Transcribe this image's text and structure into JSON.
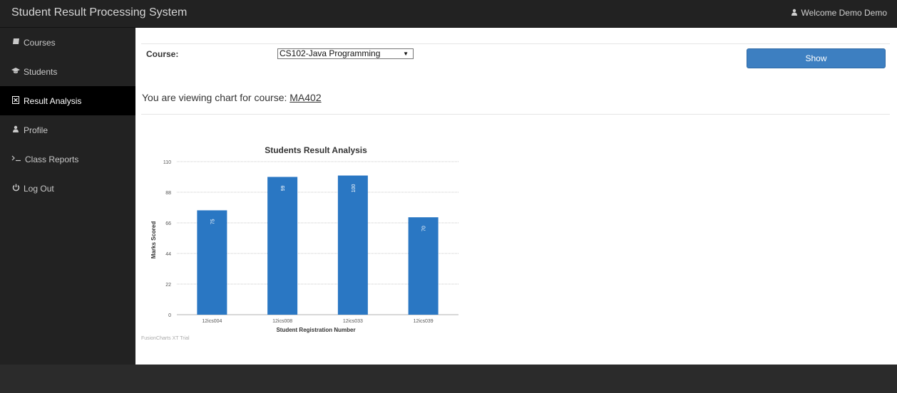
{
  "app": {
    "title": "Student Result Processing System",
    "welcome_text": "Welcome Demo Demo"
  },
  "sidebar": {
    "items": [
      {
        "label": "Courses",
        "icon": "book-icon",
        "active": false
      },
      {
        "label": "Students",
        "icon": "graduation-cap-icon",
        "active": false
      },
      {
        "label": "Result Analysis",
        "icon": "chart-file-icon",
        "active": true
      },
      {
        "label": "Profile",
        "icon": "user-icon",
        "active": false
      },
      {
        "label": "Class Reports",
        "icon": "terminal-icon",
        "active": false
      },
      {
        "label": "Log Out",
        "icon": "power-icon",
        "active": false
      }
    ]
  },
  "form": {
    "course_label": "Course:",
    "course_selected": "CS102-Java Programming",
    "show_button": "Show"
  },
  "viewing": {
    "prefix": "You are viewing chart for course: ",
    "course_code": "MA402"
  },
  "chart_data": {
    "type": "bar",
    "title": "Students Result Analysis",
    "xlabel": "Student Registration Number",
    "ylabel": "Marks Scored",
    "categories": [
      "12ics004",
      "12ics008",
      "12ics033",
      "12ics039"
    ],
    "values": [
      75,
      99,
      100,
      70
    ],
    "yticks": [
      0,
      22,
      44,
      66,
      88,
      110
    ],
    "ylim": [
      0,
      110
    ],
    "bar_color": "#2a77c3",
    "watermark": "FusionCharts XT Trial",
    "grid": true
  }
}
